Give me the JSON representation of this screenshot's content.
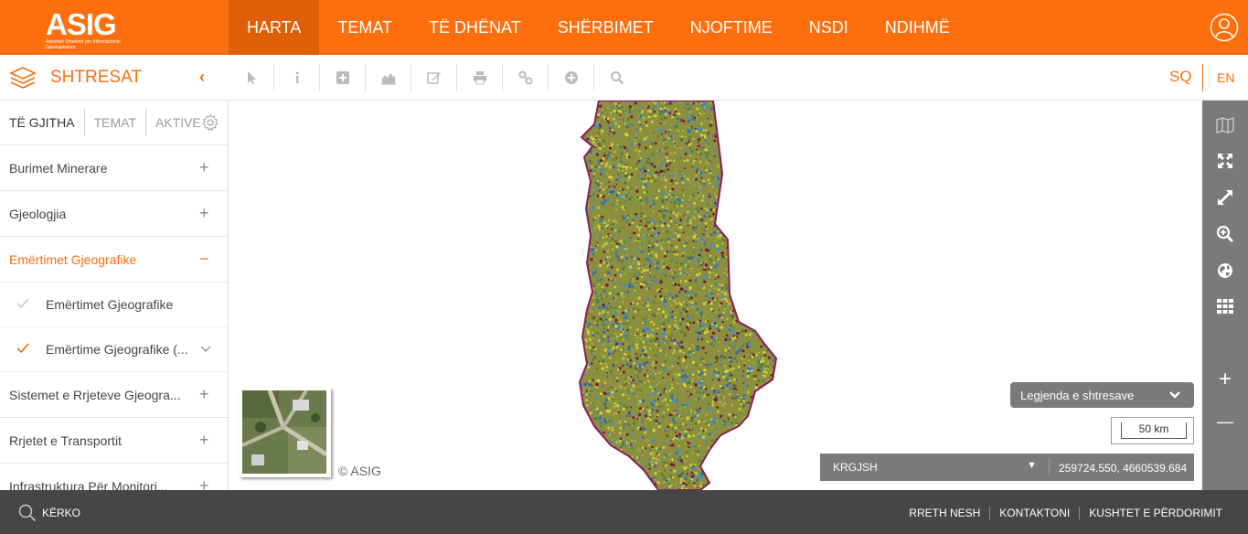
{
  "header": {
    "logo": {
      "wordmark": "ASIG",
      "tagline": "Autoriteti Shtetëror për Informacionin Gjeohapësinor"
    },
    "nav": [
      {
        "label": "HARTA",
        "active": true
      },
      {
        "label": "TEMAT"
      },
      {
        "label": "TË DHËNAT"
      },
      {
        "label": "SHËRBIMET"
      },
      {
        "label": "NJOFTIME"
      },
      {
        "label": "NSDI"
      },
      {
        "label": "NDIHMË"
      }
    ]
  },
  "toolbar": {
    "layers_title": "SHTRESAT",
    "collapse": "‹",
    "tools": [
      "pointer-icon",
      "info-icon",
      "plus-square-icon",
      "area-chart-icon",
      "edit-icon",
      "print-icon",
      "link-icon",
      "plus-circle-icon",
      "search-icon"
    ],
    "lang_sq": "SQ",
    "lang_en": "EN"
  },
  "sidebar": {
    "tabs": [
      "TË GJITHA",
      "TEMAT",
      "AKTIVE"
    ],
    "categories": [
      {
        "label": "Burimet Minerare",
        "sign": "+"
      },
      {
        "label": "Gjeologjia",
        "sign": "+"
      },
      {
        "label": "Emërtimet Gjeografike",
        "sign": "−"
      },
      {
        "label": "Sistemet e Rrjeteve Gjeogra...",
        "sign": "+"
      },
      {
        "label": "Rrjetet e Transportit",
        "sign": "+"
      },
      {
        "label": "Infrastruktura Për Monitori...",
        "sign": "+"
      }
    ],
    "sublayers": [
      {
        "label": "Emërtimet Gjeografike",
        "checked": false
      },
      {
        "label": "Emërtime Gjeografike (...",
        "checked": true
      }
    ]
  },
  "map": {
    "copyright": "© ASIG",
    "legend_label": "Legjenda e shtresave",
    "scale_label": "50 km",
    "crs": "KRGJSH",
    "coordinates": "259724.550, 4660539.684",
    "accent_color": "#ff6e0d"
  },
  "rightbar": {
    "buttons": [
      "map-icon",
      "fullscreen-icon",
      "expand-icon",
      "zoom-search-icon",
      "globe-icon",
      "grid-icon"
    ],
    "zoom_in": "+",
    "zoom_out": "—"
  },
  "footer": {
    "search": "KËRKO",
    "links": [
      "RRETH NESH",
      "KONTAKTONI",
      "KUSHTET E PËRDORIMIT"
    ]
  }
}
